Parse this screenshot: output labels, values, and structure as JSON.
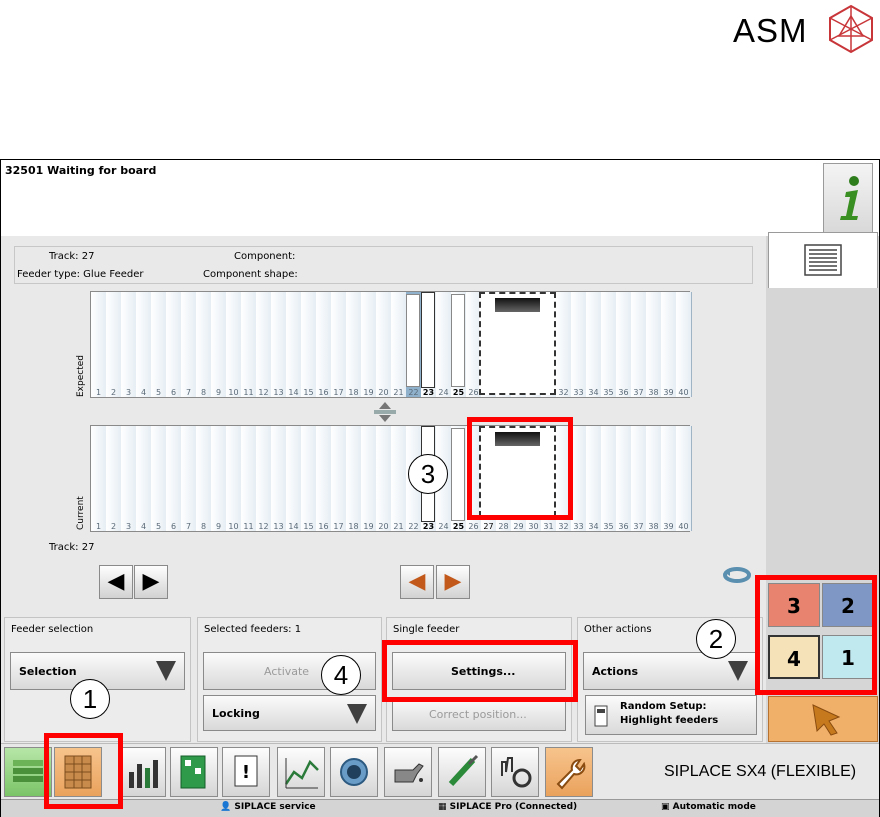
{
  "logo": {
    "text": "ASM"
  },
  "message": "32501 Waiting for board",
  "info_panel": {
    "track_label": "Track: 27",
    "component_label": "Component:",
    "feeder_type_label": "Feeder type: Glue Feeder",
    "component_shape_label": "Component shape:"
  },
  "racks": {
    "expected_label": "Expected",
    "current_label": "Current",
    "slot_numbers": [
      "1",
      "2",
      "3",
      "4",
      "5",
      "6",
      "7",
      "8",
      "9",
      "10",
      "11",
      "12",
      "13",
      "14",
      "15",
      "16",
      "17",
      "18",
      "19",
      "20",
      "21",
      "22",
      "23",
      "24",
      "25",
      "26",
      "27",
      "28",
      "29",
      "30",
      "31",
      "32",
      "33",
      "34",
      "35",
      "36",
      "37",
      "38",
      "39",
      "40"
    ],
    "selected_slot": "27"
  },
  "track_footer": "Track: 27",
  "groups": {
    "feeder_selection": {
      "title": "Feeder selection",
      "dropdown": "Selection"
    },
    "selected_feeders": {
      "title": "Selected feeders: 1",
      "activate": "Activate",
      "locking": "Locking"
    },
    "single_feeder": {
      "title": "Single feeder",
      "settings": "Settings...",
      "correct_position": "Correct position..."
    },
    "other_actions": {
      "title": "Other actions",
      "actions": "Actions",
      "random_setup_line1": "Random Setup:",
      "random_setup_line2": "Highlight feeders"
    }
  },
  "quadrants": {
    "q3": "3",
    "q2": "2",
    "q4": "4",
    "q1": "1"
  },
  "callouts": {
    "c1": "1",
    "c2": "2",
    "c3": "3",
    "c4": "4"
  },
  "machine_name": "SIPLACE SX4 (FLEXIBLE)",
  "status": {
    "service": "SIPLACE service",
    "pro": "SIPLACE Pro (Connected)",
    "mode": "Automatic mode"
  },
  "colors": {
    "highlight_red": "#ff0000",
    "q3": "#e8836f",
    "q2": "#7f97c4",
    "q4": "#f6e2b8",
    "q1": "#bfe8ef",
    "active_orange": "#f3b27a"
  }
}
